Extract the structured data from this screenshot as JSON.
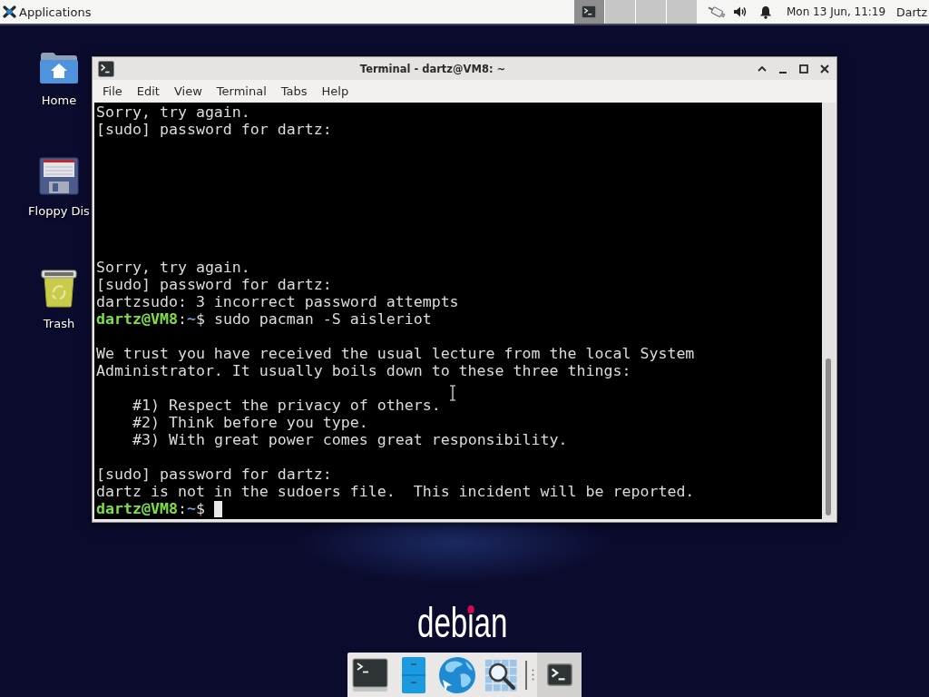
{
  "top_panel": {
    "menu_button": "Applications",
    "workspaces": [
      {
        "selected": true,
        "has_window": true
      },
      {
        "selected": false,
        "has_window": false
      },
      {
        "selected": false,
        "has_window": false
      },
      {
        "selected": false,
        "has_window": false
      }
    ],
    "clock": "Mon 13 Jun, 11:19",
    "user": "Dartz"
  },
  "desktop_icons": [
    {
      "kind": "home",
      "label": "Home"
    },
    {
      "kind": "floppy",
      "label": "Floppy Dis"
    },
    {
      "kind": "trash",
      "label": "Trash"
    }
  ],
  "terminal_window": {
    "title": "Terminal - dartz@VM8: ~",
    "menu": [
      "File",
      "Edit",
      "View",
      "Terminal",
      "Tabs",
      "Help"
    ],
    "lines": [
      {
        "kind": "text",
        "text": "Sorry, try again."
      },
      {
        "kind": "text",
        "text": "[sudo] password for dartz:"
      },
      {
        "kind": "blank"
      },
      {
        "kind": "blank"
      },
      {
        "kind": "blank"
      },
      {
        "kind": "blank"
      },
      {
        "kind": "blank"
      },
      {
        "kind": "blank"
      },
      {
        "kind": "blank"
      },
      {
        "kind": "text",
        "text": "Sorry, try again."
      },
      {
        "kind": "text",
        "text": "[sudo] password for dartz:"
      },
      {
        "kind": "text",
        "text": "dartzsudo: 3 incorrect password attempts"
      },
      {
        "kind": "prompt",
        "user": "dartz@VM8",
        "separator": ":",
        "path": "~",
        "symbol": "$",
        "command": "sudo pacman -S aisleriot",
        "cursor": false
      },
      {
        "kind": "blank"
      },
      {
        "kind": "text",
        "text": "We trust you have received the usual lecture from the local System"
      },
      {
        "kind": "text",
        "text": "Administrator. It usually boils down to these three things:"
      },
      {
        "kind": "blank"
      },
      {
        "kind": "indented",
        "text": "#1) Respect the privacy of others."
      },
      {
        "kind": "indented",
        "text": "#2) Think before you type."
      },
      {
        "kind": "indented",
        "text": "#3) With great power comes great responsibility."
      },
      {
        "kind": "blank"
      },
      {
        "kind": "text",
        "text": "[sudo] password for dartz:"
      },
      {
        "kind": "text",
        "text": "dartz is not in the sudoers file.  This incident will be reported."
      },
      {
        "kind": "prompt",
        "user": "dartz@VM8",
        "separator": ":",
        "path": "~",
        "symbol": "$",
        "cursor": true
      }
    ]
  },
  "wallpaper": {
    "logo": "debian"
  },
  "dock": {
    "launchers": [
      {
        "kind": "terminal"
      },
      {
        "kind": "files"
      },
      {
        "kind": "browser"
      },
      {
        "kind": "search"
      }
    ],
    "windows": [
      {
        "kind": "terminal",
        "selected": true
      }
    ]
  }
}
